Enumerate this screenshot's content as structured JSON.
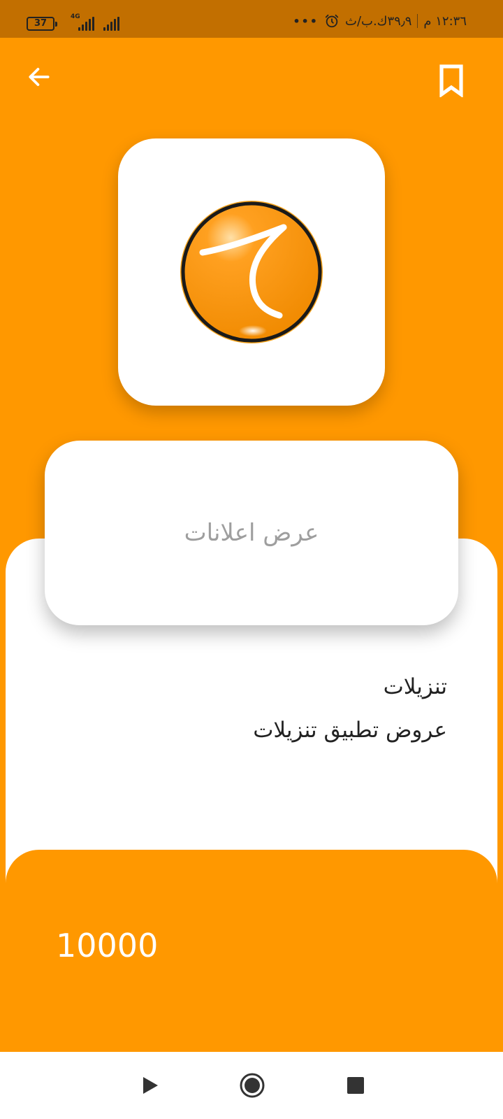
{
  "status_bar": {
    "battery": "37",
    "network": "4G",
    "time": "١٢:٣٦ م",
    "speed": "٣٩٫٩ك.ب/ث",
    "dots": "•••",
    "icons": [
      "battery-icon",
      "signal-icon",
      "alarm-icon"
    ]
  },
  "top_bar": {
    "back_icon": "arrow-left-icon",
    "bookmark_icon": "bookmark-icon"
  },
  "app_logo": {
    "glyph": "ح",
    "colors": {
      "fill": "#ff9800",
      "ring": "#1a1a1a",
      "glyph": "#ffffff"
    }
  },
  "ads_card": {
    "label": "عرض اعلانات"
  },
  "description": {
    "title": "تنزيلات",
    "subtitle": "عروض تطبيق تنزيلات"
  },
  "points": {
    "value": "10000"
  },
  "nav_bar": {
    "icons": [
      "back-triangle-icon",
      "home-circle-icon",
      "recents-square-icon"
    ]
  },
  "colors": {
    "primary": "#ff9800",
    "status_bar": "#c26f00",
    "card": "#ffffff",
    "muted_text": "#9e9e9e"
  }
}
